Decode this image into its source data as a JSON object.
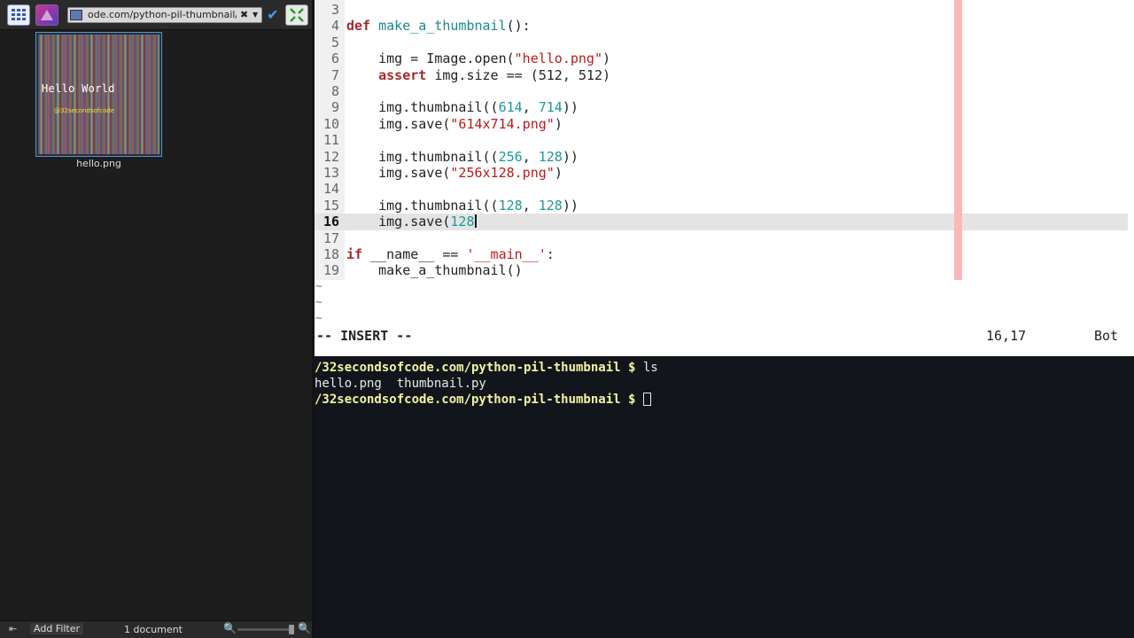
{
  "file_manager": {
    "location": "ode.com/python-pil-thumbnail/",
    "thumbnail": {
      "filename": "hello.png",
      "image_text": "Hello World",
      "image_subtext": "@32secondsofcode"
    },
    "statusbar": {
      "add_filter_label": "Add Filter",
      "document_count": "1 document"
    }
  },
  "editor": {
    "lines": [
      {
        "n": "3"
      },
      {
        "n": "4"
      },
      {
        "n": "5"
      },
      {
        "n": "6"
      },
      {
        "n": "7"
      },
      {
        "n": "8"
      },
      {
        "n": "9"
      },
      {
        "n": "10"
      },
      {
        "n": "11"
      },
      {
        "n": "12"
      },
      {
        "n": "13"
      },
      {
        "n": "14"
      },
      {
        "n": "15"
      },
      {
        "n": "16"
      },
      {
        "n": "17"
      },
      {
        "n": "18"
      },
      {
        "n": "19"
      }
    ],
    "code": {
      "l4_kw": "def",
      "l4_fn": "make_a_thumbnail",
      "l4_rest": "():",
      "l6_a": "    img = Image.open(",
      "l6_str": "\"hello.png\"",
      "l6_b": ")",
      "l7_kw": "assert",
      "l7_a": " img.size == (",
      "l7_n1": "512",
      "l7_sep": ", ",
      "l7_n2": "512",
      "l7_b": ")",
      "l9_a": "    img.thumbnail((",
      "l9_n1": "614",
      "l9_sep": ", ",
      "l9_n2": "714",
      "l9_b": "))",
      "l10_a": "    img.save(",
      "l10_str": "\"614x714.png\"",
      "l10_b": ")",
      "l12_a": "    img.thumbnail((",
      "l12_n1": "256",
      "l12_sep": ", ",
      "l12_n2": "128",
      "l12_b": "))",
      "l13_a": "    img.save(",
      "l13_str": "\"256x128.png\"",
      "l13_b": ")",
      "l15_a": "    img.thumbnail((",
      "l15_n1": "128",
      "l15_sep": ", ",
      "l15_n2": "128",
      "l15_b": "))",
      "l16_a": "    img.save(",
      "l16_n": "128",
      "l18_kw": "if",
      "l18_a": " __name__ == ",
      "l18_str": "'__main__'",
      "l18_b": ":",
      "l19_a": "    make_a_thumbnail()"
    },
    "tildes": [
      "~",
      "~",
      "~"
    ],
    "status": {
      "mode": "-- INSERT --",
      "position": "16,17",
      "scroll": "Bot"
    }
  },
  "terminal": {
    "prompt": "/32secondsofcode.com/python-pil-thumbnail $ ",
    "cmd1": "ls",
    "output1": "hello.png  thumbnail.py",
    "prompt2": "/32secondsofcode.com/python-pil-thumbnail $ "
  },
  "icons": [
    "grid-view-icon",
    "places-icon",
    "folder-icon",
    "clear-icon",
    "dropdown-icon",
    "checkmark-icon",
    "fit-icon",
    "panel-icon",
    "zoom-out-icon",
    "zoom-in-icon"
  ]
}
